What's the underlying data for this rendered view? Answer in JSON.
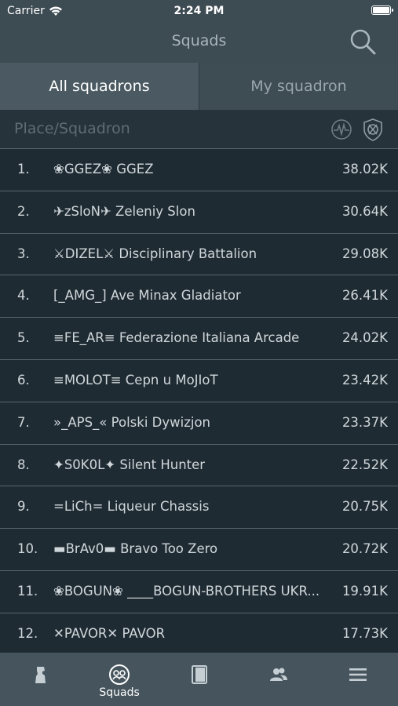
{
  "status": {
    "carrier": "Carrier",
    "time": "2:24 PM"
  },
  "nav": {
    "title": "Squads"
  },
  "tabs": {
    "all": "All squadrons",
    "mine": "My squadron"
  },
  "header": {
    "label": "Place/Squadron"
  },
  "rows": [
    {
      "rank": "1.",
      "name": "❀GGEZ❀ GGEZ",
      "score": "38.02K"
    },
    {
      "rank": "2.",
      "name": "✈zSloN✈ Zeleniy Slon",
      "score": "30.64K"
    },
    {
      "rank": "3.",
      "name": "⚔DIZEL⚔ Disciplinary Battalion",
      "score": "29.08K"
    },
    {
      "rank": "4.",
      "name": "[_AMG_] Ave Minax Gladiator",
      "score": "26.41K"
    },
    {
      "rank": "5.",
      "name": "≡FE_AR≡ Federazione Italiana Arcade",
      "score": "24.02K"
    },
    {
      "rank": "6.",
      "name": "≡MOLOT≡ Cepn u MoJIoT",
      "score": "23.42K"
    },
    {
      "rank": "7.",
      "name": "»_APS_« Polski Dywizjon",
      "score": "23.37K"
    },
    {
      "rank": "8.",
      "name": "✦S0K0L✦ Silent Hunter",
      "score": "22.52K"
    },
    {
      "rank": "9.",
      "name": "=LiCh= Liqueur  Chassis",
      "score": "20.75K"
    },
    {
      "rank": "10.",
      "name": "▬BrAv0▬ Bravo Too Zero",
      "score": "20.72K"
    },
    {
      "rank": "11.",
      "name": "❀BOGUN❀ ____BOGUN-BROTHERS UKR...",
      "score": "19.91K"
    },
    {
      "rank": "12.",
      "name": "✕PAVOR✕ PAVOR",
      "score": "17.73K"
    }
  ],
  "tabbar": {
    "items": [
      {
        "icon": "soldier-icon",
        "label": ""
      },
      {
        "icon": "squads-icon",
        "label": "Squads"
      },
      {
        "icon": "book-icon",
        "label": ""
      },
      {
        "icon": "friends-icon",
        "label": ""
      },
      {
        "icon": "menu-icon",
        "label": ""
      }
    ]
  }
}
